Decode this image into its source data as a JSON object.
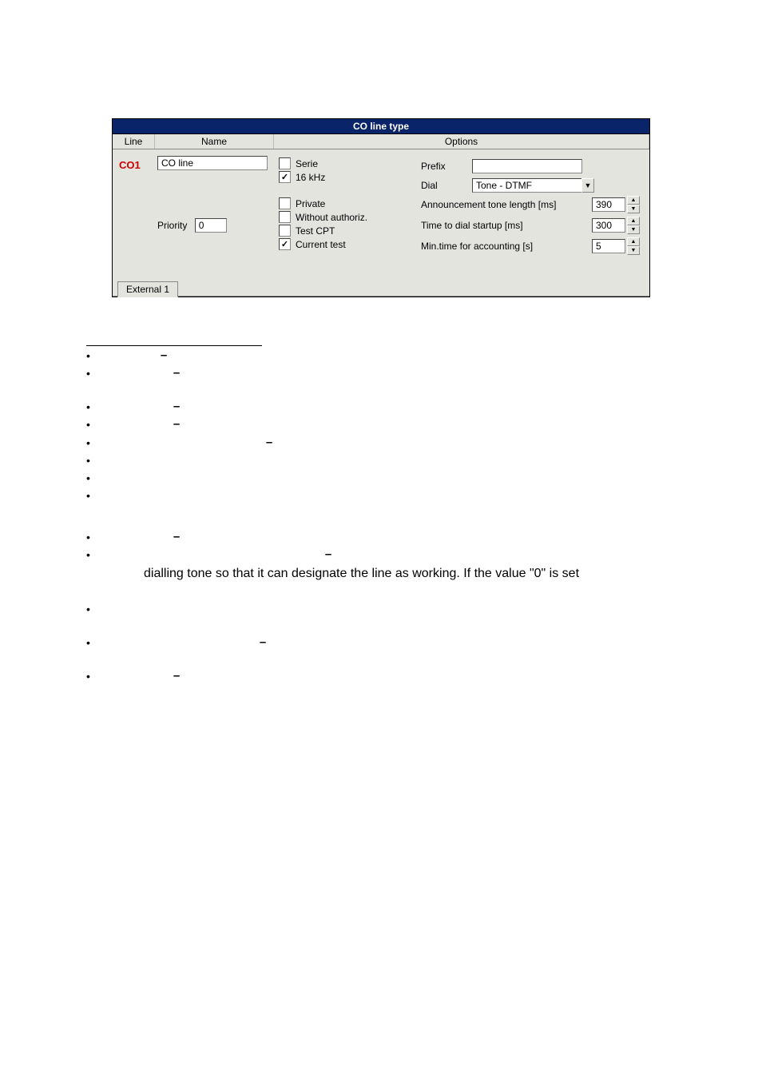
{
  "panel": {
    "title": "CO line type",
    "header": {
      "line": "Line",
      "name": "Name",
      "options": "Options"
    },
    "row": {
      "id": "CO1",
      "name_value": "CO line",
      "priority_label": "Priority",
      "priority_value": "0"
    },
    "checks": {
      "serie": "Serie",
      "khz16": "16 kHz",
      "private": "Private",
      "without_authoriz": "Without authoriz.",
      "test_cpt": "Test CPT",
      "current_test": "Current test"
    },
    "right": {
      "prefix_label": "Prefix",
      "prefix_value": "",
      "dial_label": "Dial",
      "dial_value": "Tone - DTMF",
      "ann_label": "Announcement tone length [ms]",
      "ann_value": "390",
      "dialstartup_label": "Time to dial startup [ms]",
      "dialstartup_value": "300",
      "minacc_label": "Min.time for accounting [s]",
      "minacc_value": "5"
    },
    "tab": "External 1"
  },
  "doc": {
    "visible_line": "dialling tone so that it can designate the line as working. If the value \"0\" is set"
  }
}
